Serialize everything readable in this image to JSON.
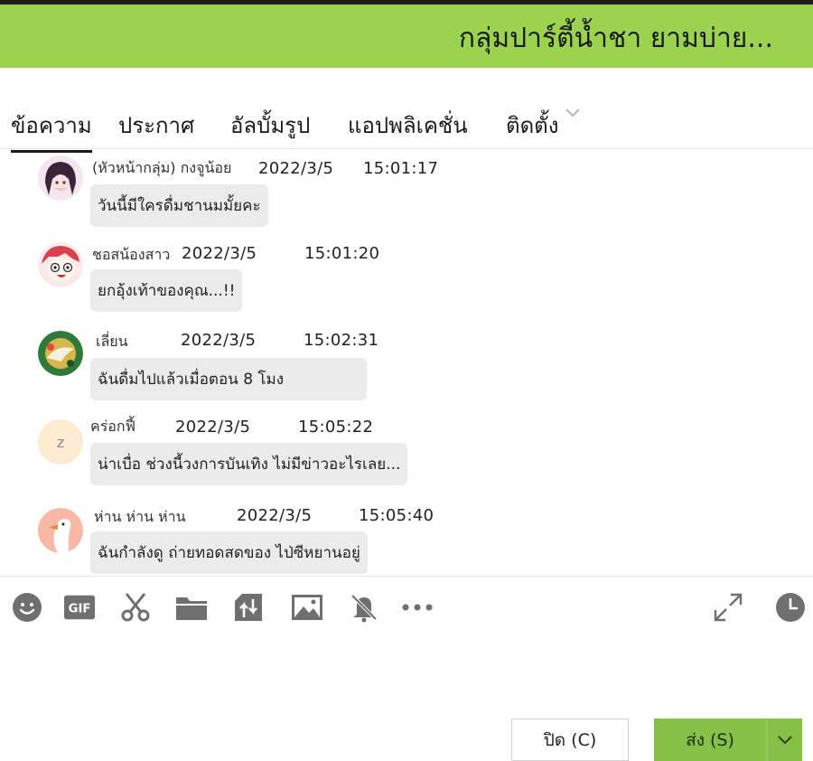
{
  "window": {
    "title": "กลุ่มปาร์ตี้น้ำชา  ยามบ่าย...",
    "accent_color": "#9bd34e"
  },
  "tabs": [
    {
      "label": "ข้อความ",
      "active": true
    },
    {
      "label": "ประกาศ",
      "active": false
    },
    {
      "label": "อัลบั้มรูป",
      "active": false
    },
    {
      "label": "แอปพลิเคชั่น",
      "active": false
    },
    {
      "label": "ติดตั้ง",
      "active": false
    }
  ],
  "messages": [
    {
      "sender": "(หัวหน้ากลุ่ม) กงจูน้อย",
      "date": "2022/3/5",
      "time": "15:01:17",
      "text": "วันนี้มีใครดื่มชานมมั้ยคะ",
      "avatar": "anime-girl-purple-hair"
    },
    {
      "sender": "ชอสน้องสาว",
      "date": "2022/3/5",
      "time": "15:01:20",
      "text": "ยกอุ้งเท้าของคุณ...!!",
      "avatar": "anime-girl-red-hair"
    },
    {
      "sender": "เลี่ยน",
      "date": "2022/3/5",
      "time": "15:02:31",
      "text": "ฉันดื่มไปแล้วเมื่อตอน 8 โมง",
      "avatar": "green-circle-character"
    },
    {
      "sender": "คร่อกฟี้",
      "date": "2022/3/5",
      "time": "15:05:22",
      "text": "น่าเบื่อ ช่วงนี้วงการบันเทิง ไม่มีข่าวอะไรเลย...",
      "avatar": "sleeping-z"
    },
    {
      "sender": "ห่าน ห่าน ห่าน",
      "date": "2022/3/5",
      "time": "15:05:40",
      "text": "ฉันกำลังดู ถ่ายทอดสดของ ไป่ซีหยานอยู่",
      "avatar": "goose"
    }
  ],
  "toolbar": {
    "icons": [
      "emoji-icon",
      "gif-icon",
      "scissors-icon",
      "folder-icon",
      "file-transfer-icon",
      "image-icon",
      "bell-off-icon",
      "more-icon",
      "expand-icon",
      "history-clock-icon"
    ],
    "gif_label": "GIF"
  },
  "actions": {
    "close_label": "ปิด (C)",
    "send_label": "ส่ง (S)"
  }
}
